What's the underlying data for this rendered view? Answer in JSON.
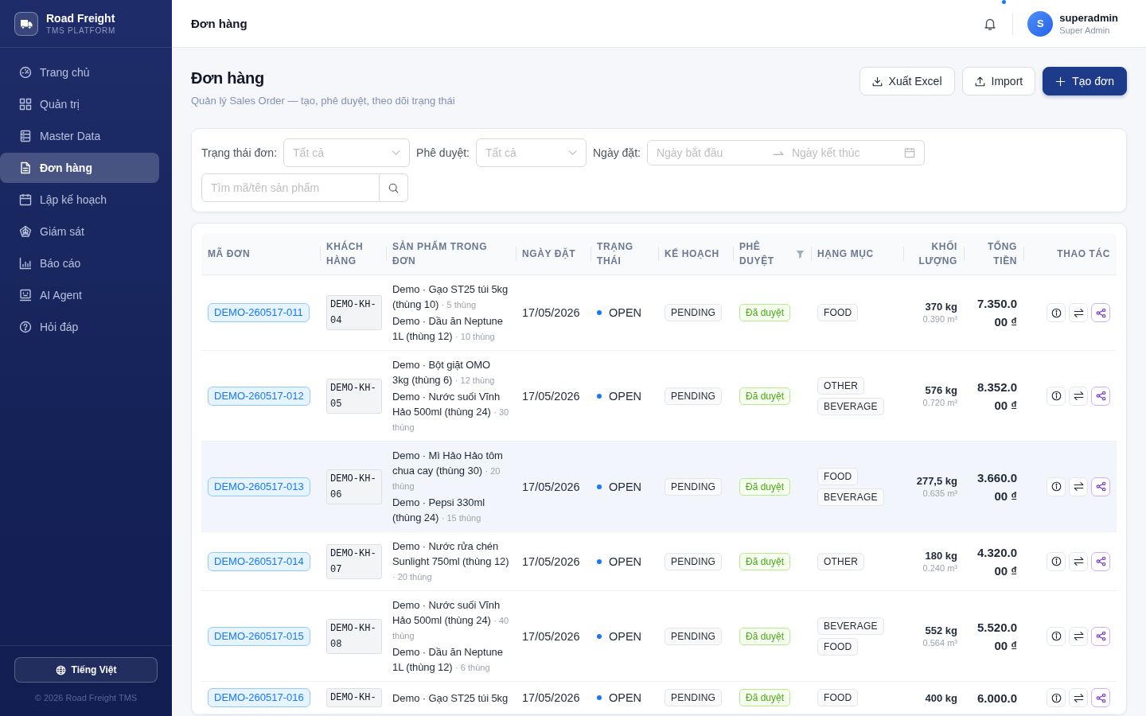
{
  "sidebar": {
    "brand": {
      "title": "Road Freight",
      "subtitle": "TMS PLATFORM"
    },
    "items": [
      {
        "label": "Trang chủ",
        "selected": false
      },
      {
        "label": "Quản trị",
        "selected": false
      },
      {
        "label": "Master Data",
        "selected": false
      },
      {
        "label": "Đơn hàng",
        "selected": true
      },
      {
        "label": "Lập kế hoạch",
        "selected": false
      },
      {
        "label": "Giám sát",
        "selected": false
      },
      {
        "label": "Báo cáo",
        "selected": false
      },
      {
        "label": "AI Agent",
        "selected": false
      },
      {
        "label": "Hỏi đáp",
        "selected": false
      }
    ],
    "language_button": "Tiếng Việt",
    "footer": "© 2026 Road Freight TMS"
  },
  "header": {
    "title": "Đơn hàng",
    "notifications": {
      "unread": true
    },
    "user": {
      "avatar": "S",
      "name": "superadmin",
      "role": "Super Admin"
    }
  },
  "page": {
    "title": "Đơn hàng",
    "subtitle": "Quản lý Sales Order — tạo, phê duyệt, theo dõi trạng thái",
    "buttons": [
      {
        "label": "Xuất Excel",
        "kind": "default"
      },
      {
        "label": "Import",
        "kind": "default"
      },
      {
        "label": "Tạo đơn",
        "kind": "primary"
      }
    ]
  },
  "filters": {
    "status": {
      "label": "Trạng thái đơn:",
      "placeholder": "Tất cả"
    },
    "approval": {
      "label": "Phê duyệt:",
      "placeholder": "Tất cả"
    },
    "date": {
      "label": "Ngày đặt:",
      "start_placeholder": "Ngày bắt đầu",
      "end_placeholder": "Ngày kết thúc"
    },
    "search": {
      "placeholder": "Tìm mã/tên sản phẩm"
    }
  },
  "table": {
    "columns": [
      {
        "label": "MÃ ĐƠN",
        "filter": false
      },
      {
        "label": "KHÁCH HÀNG",
        "filter": false
      },
      {
        "label": "SẢN PHẨM TRONG ĐƠN",
        "filter": false
      },
      {
        "label": "NGÀY ĐẶT",
        "filter": false
      },
      {
        "label": "TRẠNG THÁI",
        "filter": false
      },
      {
        "label": "KẾ HOẠCH",
        "filter": false
      },
      {
        "label": "PHÊ DUYỆT",
        "filter": true
      },
      {
        "label": "HẠNG MỤC",
        "filter": false
      },
      {
        "label": "KHỐI LƯỢNG",
        "filter": false
      },
      {
        "label": "TỔNG TIỀN",
        "filter": false
      },
      {
        "label": "THAO TÁC",
        "filter": false
      }
    ],
    "rows": [
      {
        "order_id": "DEMO-260517-011",
        "customer": "DEMO-KH-04",
        "products": [
          {
            "name": "Demo · Gạo ST25 túi 5kg (thùng 10)",
            "qty": "· 5 thùng"
          },
          {
            "name": "Demo · Dầu ăn Neptune 1L (thùng 12)",
            "qty": "· 10 thùng"
          }
        ],
        "date": "17/05/2026",
        "status": "OPEN",
        "plan": "PENDING",
        "approval": "Đã duyệt",
        "categories": [
          "FOOD"
        ],
        "weight": "370 kg",
        "volume": "0.390 m³",
        "total": "7.350.000 ₫",
        "hovered": false
      },
      {
        "order_id": "DEMO-260517-012",
        "customer": "DEMO-KH-05",
        "products": [
          {
            "name": "Demo · Bột giặt OMO 3kg (thùng 6)",
            "qty": "· 12 thùng"
          },
          {
            "name": "Demo · Nước suối Vĩnh Hảo 500ml (thùng 24)",
            "qty": "· 30 thùng"
          }
        ],
        "date": "17/05/2026",
        "status": "OPEN",
        "plan": "PENDING",
        "approval": "Đã duyệt",
        "categories": [
          "OTHER",
          "BEVERAGE"
        ],
        "weight": "576 kg",
        "volume": "0.720 m³",
        "total": "8.352.000 ₫",
        "hovered": false
      },
      {
        "order_id": "DEMO-260517-013",
        "customer": "DEMO-KH-06",
        "products": [
          {
            "name": "Demo · Mì Hảo Hảo tôm chua cay (thùng 30)",
            "qty": "· 20 thùng"
          },
          {
            "name": "Demo · Pepsi 330ml (thùng 24)",
            "qty": "· 15 thùng"
          }
        ],
        "date": "17/05/2026",
        "status": "OPEN",
        "plan": "PENDING",
        "approval": "Đã duyệt",
        "categories": [
          "FOOD",
          "BEVERAGE"
        ],
        "weight": "277,5 kg",
        "volume": "0.635 m³",
        "total": "3.660.000 ₫",
        "hovered": true
      },
      {
        "order_id": "DEMO-260517-014",
        "customer": "DEMO-KH-07",
        "products": [
          {
            "name": "Demo · Nước rửa chén Sunlight 750ml (thùng 12)",
            "qty": "· 20 thùng"
          }
        ],
        "date": "17/05/2026",
        "status": "OPEN",
        "plan": "PENDING",
        "approval": "Đã duyệt",
        "categories": [
          "OTHER"
        ],
        "weight": "180 kg",
        "volume": "0.240 m³",
        "total": "4.320.000 ₫",
        "hovered": false
      },
      {
        "order_id": "DEMO-260517-015",
        "customer": "DEMO-KH-08",
        "products": [
          {
            "name": "Demo · Nước suối Vĩnh Hảo 500ml (thùng 24)",
            "qty": "· 40 thùng"
          },
          {
            "name": "Demo · Dầu ăn Neptune 1L (thùng 12)",
            "qty": "· 6 thùng"
          }
        ],
        "date": "17/05/2026",
        "status": "OPEN",
        "plan": "PENDING",
        "approval": "Đã duyệt",
        "categories": [
          "BEVERAGE",
          "FOOD"
        ],
        "weight": "552 kg",
        "volume": "0.564 m³",
        "total": "5.520.000 ₫",
        "hovered": false
      },
      {
        "order_id": "DEMO-260517-016",
        "customer": "DEMO-KH-",
        "products": [
          {
            "name": "Demo · Gạo ST25 túi 5kg"
          }
        ],
        "date": "17/05/2026",
        "status": "OPEN",
        "plan": "PENDING",
        "approval": "Đã duyệt",
        "categories": [
          "FOOD"
        ],
        "weight": "400 kg",
        "total": "6.000.0",
        "hovered": false
      }
    ]
  }
}
